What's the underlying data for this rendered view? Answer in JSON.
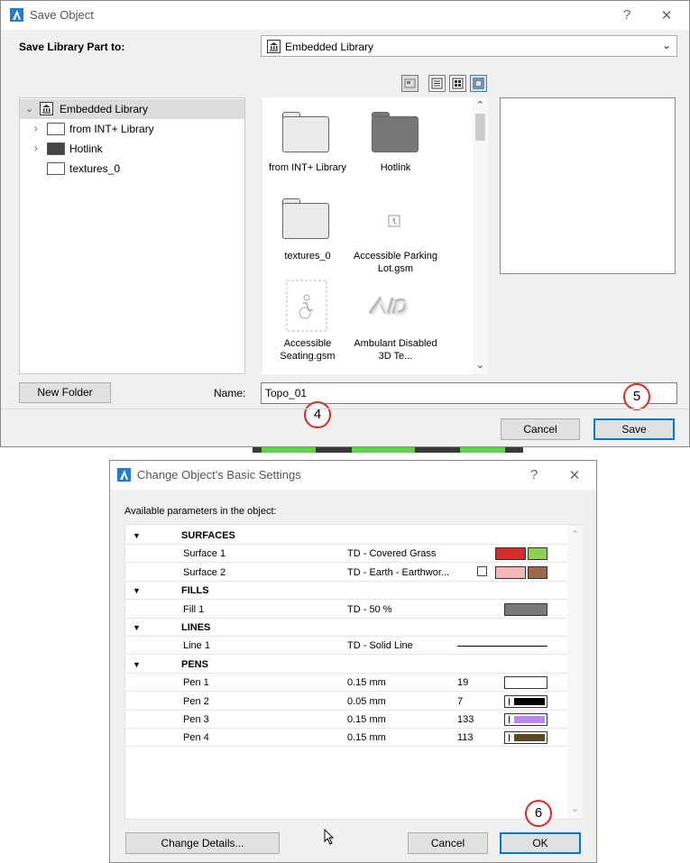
{
  "save_dialog": {
    "title": "Save Object",
    "help": "?",
    "close": "✕",
    "save_to_label": "Save Library Part to:",
    "save_to_value": "Embedded Library",
    "tree": [
      {
        "label": "Embedded Library",
        "icon": "library-icon",
        "expanded": true
      },
      {
        "label": "from INT+ Library",
        "icon": "folder-icon"
      },
      {
        "label": "Hotlink",
        "icon": "folder-dark-icon"
      },
      {
        "label": "textures_0",
        "icon": "folder-icon"
      }
    ],
    "grid_items": [
      {
        "label": "from INT+ Library",
        "icon": "folder-icon"
      },
      {
        "label": "Hotlink",
        "icon": "folder-dark-icon"
      },
      {
        "label": "textures_0",
        "icon": "folder-icon"
      },
      {
        "label": "Accessible Parking Lot.gsm",
        "icon": "parking-object-icon"
      },
      {
        "label": "Accessible Seating.gsm",
        "icon": "seating-object-icon"
      },
      {
        "label": "Ambulant Disabled 3D Te...",
        "icon": "3d-text-object-icon"
      }
    ],
    "new_folder": "New Folder",
    "name_label": "Name:",
    "name_value": "Topo_01",
    "cancel": "Cancel",
    "save": "Save",
    "callout_4": "4",
    "callout_5": "5"
  },
  "settings_dialog": {
    "title": "Change Object's Basic Settings",
    "help": "?",
    "close": "✕",
    "params_label": "Available parameters in the object:",
    "rows": [
      {
        "kind": "header",
        "name": "SURFACES"
      },
      {
        "kind": "item",
        "name": "Surface 1",
        "value": "TD - Covered Grass",
        "swatch": "surface1"
      },
      {
        "kind": "item",
        "name": "Surface 2",
        "value": "TD - Earth - Earthwor...",
        "swatch": "surface2"
      },
      {
        "kind": "header",
        "name": "FILLS"
      },
      {
        "kind": "item",
        "name": "Fill 1",
        "value": "TD - 50 %",
        "swatch": "fill"
      },
      {
        "kind": "header",
        "name": "LINES"
      },
      {
        "kind": "item",
        "name": "Line 1",
        "value": "TD - Solid Line",
        "swatch": "line"
      },
      {
        "kind": "header",
        "name": "PENS"
      },
      {
        "kind": "item",
        "name": "Pen 1",
        "value": "0.15 mm",
        "num": "19",
        "swatch": "pen",
        "color": "#ffffff"
      },
      {
        "kind": "item",
        "name": "Pen 2",
        "value": "0.05 mm",
        "num": "7",
        "swatch": "pen",
        "color": "#000000"
      },
      {
        "kind": "item",
        "name": "Pen 3",
        "value": "0.15 mm",
        "num": "133",
        "swatch": "pen",
        "color": "#bb88ee"
      },
      {
        "kind": "item",
        "name": "Pen 4",
        "value": "0.15 mm",
        "num": "113",
        "swatch": "pen",
        "color": "#5a4a22"
      }
    ],
    "change_details": "Change Details...",
    "cancel": "Cancel",
    "ok": "OK",
    "callout_6": "6"
  },
  "colors": {
    "accent": "#0078d7",
    "callout": "#e0281b",
    "grass_red": "#d62b2b",
    "grass_green": "#8fd14f",
    "earth_pink": "#f4b8b8",
    "earth_brown": "#9a6a4a",
    "fill_gray": "#7a7a7a"
  }
}
